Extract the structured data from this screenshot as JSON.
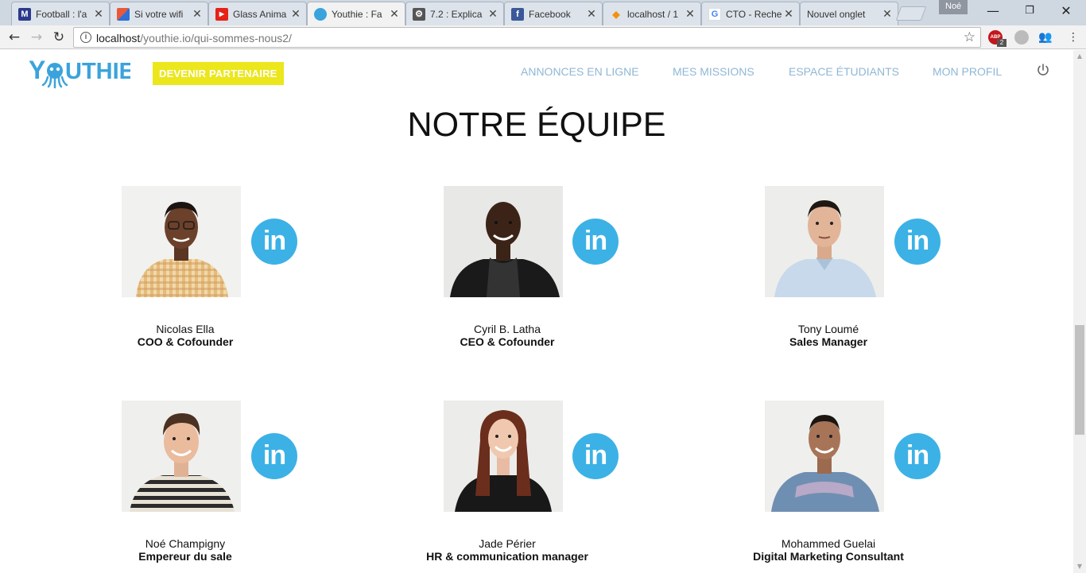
{
  "browser": {
    "tabs": [
      {
        "title": "Football : l'a",
        "favicon": "m-logo-icon",
        "color": "#2b3a8c",
        "glyph": "M"
      },
      {
        "title": "Si votre wifi",
        "favicon": "article-icon",
        "color": "#e8593c",
        "glyph": ""
      },
      {
        "title": "Glass Anima",
        "favicon": "youtube-icon",
        "color": "#e62117",
        "glyph": "▶"
      },
      {
        "title": "Youthie : Fa",
        "favicon": "youthie-icon",
        "color": "#3aa3dc",
        "glyph": ""
      },
      {
        "title": "7.2 : Explica",
        "favicon": "gear-icon",
        "color": "#555555",
        "glyph": "⚙"
      },
      {
        "title": "Facebook",
        "favicon": "facebook-icon",
        "color": "#3b5998",
        "glyph": "f"
      },
      {
        "title": "localhost / 1",
        "favicon": "phpmyadmin-icon",
        "color": "#f29111",
        "glyph": "◆"
      },
      {
        "title": "CTO - Reche",
        "favicon": "google-icon",
        "color": "#ffffff",
        "glyph": "G"
      },
      {
        "title": "Nouvel onglet",
        "favicon": "none",
        "color": "transparent",
        "glyph": ""
      }
    ],
    "active_tab": 3,
    "profile_name": "Noé",
    "url_host": "localhost",
    "url_path": "/youthie.io/qui-sommes-nous2/",
    "abp_badge": "2"
  },
  "site": {
    "logo_text": "YOUTHIE",
    "partner_button": "DEVENIR PARTENAIRE",
    "nav": [
      "ANNONCES EN LIGNE",
      "MES MISSIONS",
      "ESPACE ÉTUDIANTS",
      "MON PROFIL"
    ],
    "accent_color": "#3aa3dc",
    "partner_color": "#ece61c"
  },
  "section_title": "NOTRE ÉQUIPE",
  "team": [
    {
      "name": "Nicolas Ella",
      "role": "COO & Cofounder",
      "linkedin": "in"
    },
    {
      "name": "Cyril B. Latha",
      "role": "CEO & Cofounder",
      "linkedin": "in"
    },
    {
      "name": "Tony Loumé",
      "role": "Sales Manager",
      "linkedin": "in"
    },
    {
      "name": "Noé Champigny",
      "role": "Empereur du sale",
      "linkedin": "in"
    },
    {
      "name": "Jade Périer",
      "role": "HR & communication manager",
      "linkedin": "in"
    },
    {
      "name": "Mohammed Guelai",
      "role": "Digital Marketing Consultant",
      "linkedin": "in"
    }
  ]
}
